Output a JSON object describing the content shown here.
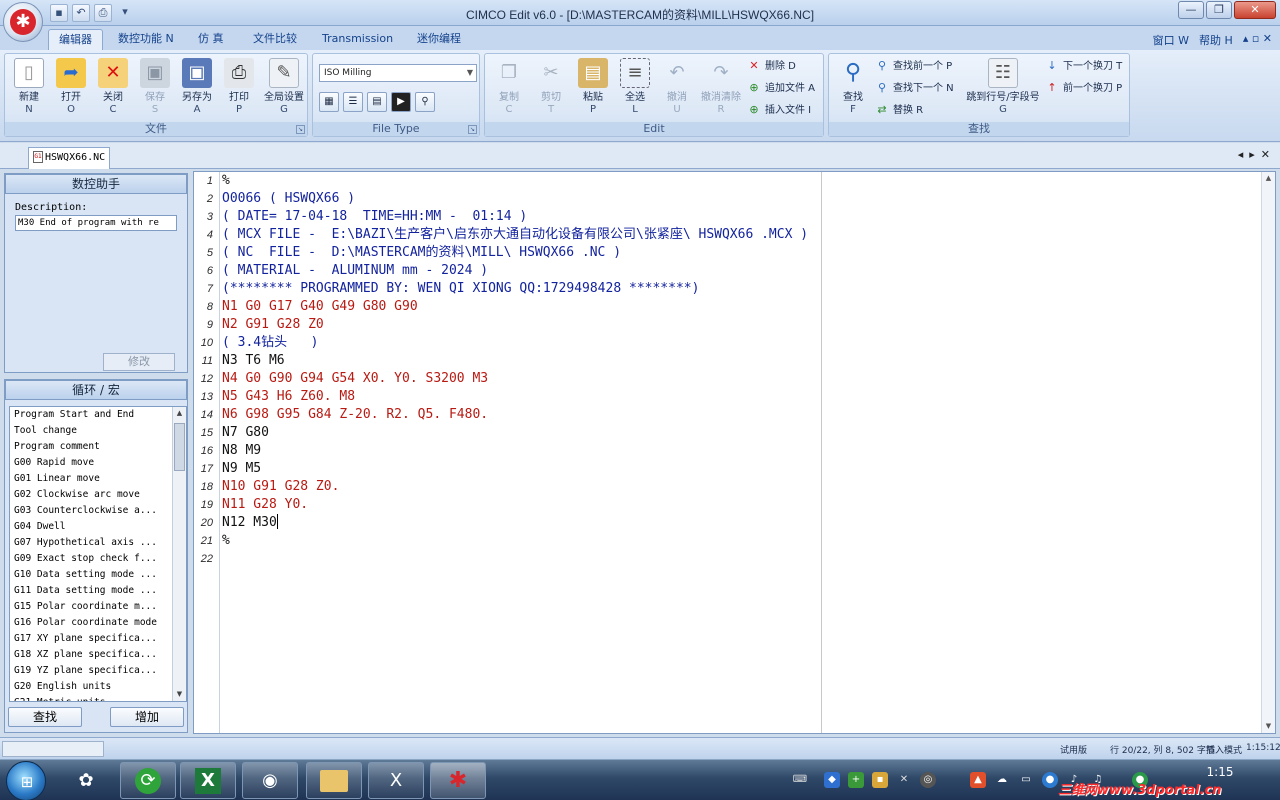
{
  "window": {
    "title": "CIMCO Edit v6.0 - [D:\\MASTERCAM的资料\\MILL\\HSWQX66.NC]"
  },
  "ribbon_tabs": [
    "编辑器",
    "数控功能 N",
    "仿 真",
    "文件比较",
    "Transmission",
    "迷你编程"
  ],
  "ribbon_right": {
    "window": "窗口 W",
    "help": "帮助 H"
  },
  "groups": {
    "file": {
      "label": "文件",
      "buttons": [
        {
          "label": "新建",
          "key": "N"
        },
        {
          "label": "打开",
          "key": "O"
        },
        {
          "label": "关闭",
          "key": "C"
        },
        {
          "label": "保存",
          "key": "S"
        },
        {
          "label": "另存为",
          "key": "A"
        },
        {
          "label": "打印",
          "key": "P"
        },
        {
          "label": "全局设置",
          "key": "G"
        }
      ]
    },
    "filetype": {
      "label": "File Type",
      "selected": "ISO Milling"
    },
    "edit": {
      "label": "Edit",
      "buttons": [
        {
          "label": "复制",
          "key": "C"
        },
        {
          "label": "剪切",
          "key": "T"
        },
        {
          "label": "粘贴",
          "key": "P"
        },
        {
          "label": "全选",
          "key": "L"
        },
        {
          "label": "撤消",
          "key": "U"
        },
        {
          "label": "撤消清除",
          "key": "R"
        }
      ],
      "small": [
        "删除 D",
        "追加文件 A",
        "插入文件 I"
      ]
    },
    "find": {
      "label": "查找",
      "find": {
        "label": "查找",
        "key": "F"
      },
      "small": [
        "查找前一个 P",
        "查找下一个 N",
        "替换 R"
      ],
      "goto": {
        "label": "跳到行号/字段号",
        "key": "G"
      },
      "tool": [
        "下一个换刀 T",
        "前一个换刀 P"
      ]
    }
  },
  "document_tab": "HSWQX66.NC",
  "assistant": {
    "title": "数控助手",
    "description_label": "Description:",
    "description_value": "M30 End of program with re",
    "modify_button": "修改"
  },
  "macros": {
    "title": "循环 / 宏",
    "items": [
      "Program Start and End",
      "Tool change",
      "Program comment",
      "G00 Rapid move",
      "G01 Linear move",
      "G02 Clockwise arc move",
      "G03 Counterclockwise a...",
      "G04 Dwell",
      "G07 Hypothetical axis ...",
      "G09 Exact stop check f...",
      "G10 Data setting mode ...",
      "G11 Data setting mode ...",
      "G15 Polar coordinate m...",
      "G16 Polar coordinate mode",
      "G17 XY plane specifica...",
      "G18 XZ plane specifica...",
      "G19 YZ plane specifica...",
      "G20 English units",
      "G21 Metric units"
    ],
    "find_button": "查找",
    "add_button": "增加"
  },
  "code_lines": [
    {
      "n": "1",
      "text": "%",
      "style": "black"
    },
    {
      "n": "2",
      "text": "O0066 ( HSWQX66 )",
      "style": "comment"
    },
    {
      "n": "3",
      "text": "( DATE= 17-04-18  TIME=HH:MM -  01:14 )",
      "style": "comment"
    },
    {
      "n": "4",
      "text": "( MCX FILE -  E:\\BAZI\\生产客户\\启东亦大通自动化设备有限公司\\张紧座\\ HSWQX66 .MCX )",
      "style": "comment"
    },
    {
      "n": "5",
      "text": "( NC  FILE -  D:\\MASTERCAM的资料\\MILL\\ HSWQX66 .NC )",
      "style": "comment"
    },
    {
      "n": "6",
      "text": "( MATERIAL -  ALUMINUM mm - 2024 )",
      "style": "comment"
    },
    {
      "n": "7",
      "text": "(******** PROGRAMMED BY: WEN QI XIONG QQ:1729498428 ********)",
      "style": "comment"
    },
    {
      "n": "8",
      "text": "N1 G0 G17 G40 G49 G80 G90",
      "style": "red"
    },
    {
      "n": "9",
      "text": "N2 G91 G28 Z0",
      "style": "red"
    },
    {
      "n": "10",
      "text": "( 3.4钻头   )",
      "style": "comment"
    },
    {
      "n": "11",
      "text": "N3 T6 M6",
      "style": "black"
    },
    {
      "n": "12",
      "text": "N4 G0 G90 G94 G54 X0. Y0. S3200 M3",
      "style": "red"
    },
    {
      "n": "13",
      "text": "N5 G43 H6 Z60. M8",
      "style": "red"
    },
    {
      "n": "14",
      "text": "N6 G98 G95 G84 Z-20. R2. Q5. F480.",
      "style": "red"
    },
    {
      "n": "15",
      "text": "N7 G80",
      "style": "black"
    },
    {
      "n": "16",
      "text": "N8 M9",
      "style": "black"
    },
    {
      "n": "17",
      "text": "N9 M5",
      "style": "black"
    },
    {
      "n": "18",
      "text": "N10 G91 G28 Z0.",
      "style": "red"
    },
    {
      "n": "19",
      "text": "N11 G28 Y0.",
      "style": "red"
    },
    {
      "n": "20",
      "text": "N12 M30",
      "style": "black"
    },
    {
      "n": "21",
      "text": "%",
      "style": "black"
    },
    {
      "n": "22",
      "text": "",
      "style": "black"
    }
  ],
  "status": {
    "trial": "试用版",
    "position": "行 20/22, 列 8, 502 字节",
    "mode": "插入模式",
    "time": "1:15:12"
  },
  "taskbar": {
    "clock": "1:15",
    "watermark": "三维网www.3dportal.cn"
  },
  "colors": {
    "comment": "#13239e",
    "code_red": "#b81a12",
    "ribbon_bg": "#d3e1f3",
    "taskbar": "#2f4868"
  }
}
